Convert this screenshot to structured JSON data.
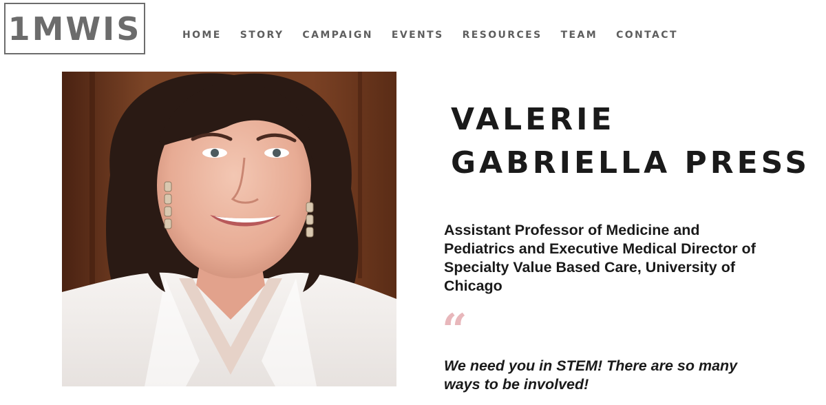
{
  "header": {
    "logo": "1MWIS",
    "nav": [
      {
        "label": "HOME"
      },
      {
        "label": "STORY"
      },
      {
        "label": "CAMPAIGN"
      },
      {
        "label": "EVENTS"
      },
      {
        "label": "RESOURCES"
      },
      {
        "label": "TEAM"
      },
      {
        "label": "CONTACT"
      }
    ]
  },
  "profile": {
    "name_line1": "VALERIE",
    "name_line2": "GABRIELLA PRESS",
    "title": "Assistant Professor of Medicine and Pediatrics and Executive Medical Director of Specialty Value Based Care, University of Chicago",
    "quote_mark": "“",
    "quote": "We need you in STEM! There are so many ways to be involved!"
  },
  "colors": {
    "logo_gray": "#6c6c6c",
    "nav_gray": "#5e5e5e",
    "quote_mark_pink": "#e8b7bb",
    "text_dark": "#1a1a1a"
  }
}
